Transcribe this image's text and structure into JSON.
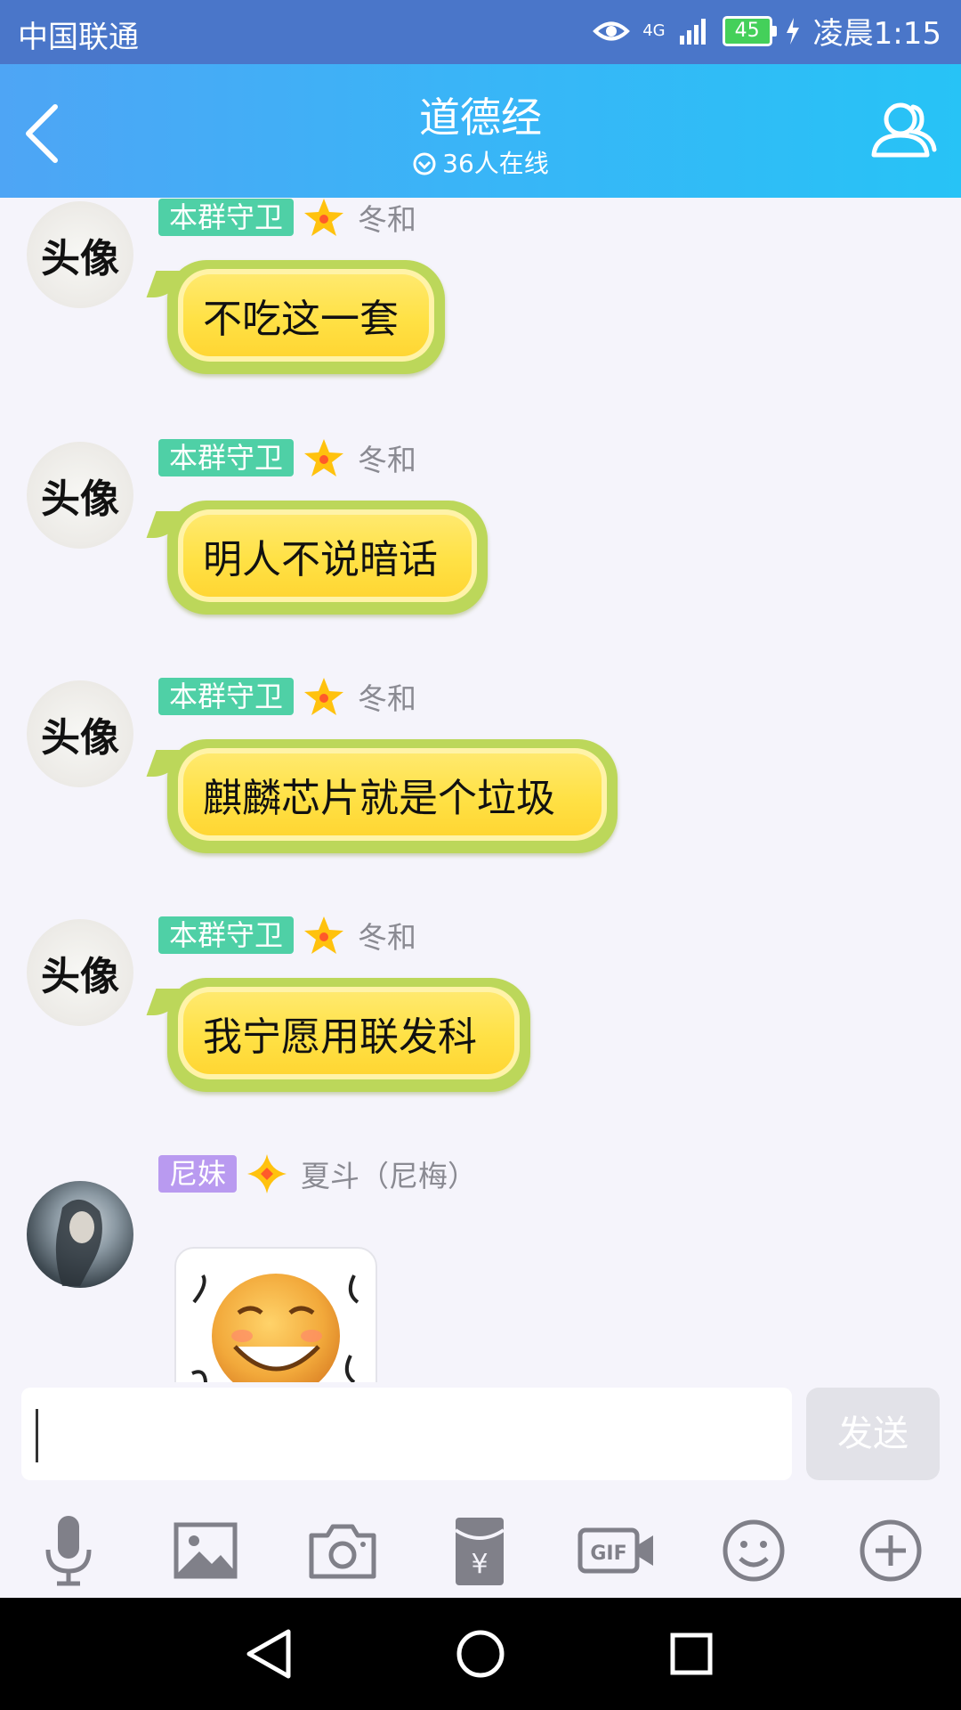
{
  "status_bar": {
    "carrier": "中国联通",
    "network": "4G",
    "battery": "45",
    "time": "凌晨1:15"
  },
  "header": {
    "title": "道德经",
    "online": "36人在线"
  },
  "messages": [
    {
      "avatar_text": "头像",
      "badge": "本群守卫",
      "nickname": "冬和",
      "text": "不吃这一套"
    },
    {
      "avatar_text": "头像",
      "badge": "本群守卫",
      "nickname": "冬和",
      "text": "明人不说暗话"
    },
    {
      "avatar_text": "头像",
      "badge": "本群守卫",
      "nickname": "冬和",
      "text": "麒麟芯片就是个垃圾"
    },
    {
      "avatar_text": "头像",
      "badge": "本群守卫",
      "nickname": "冬和",
      "text": "我宁愿用联发科"
    },
    {
      "badge": "尼妹",
      "nickname": "夏斗（尼梅）",
      "content": "sticker-smiley"
    }
  ],
  "input": {
    "value": "",
    "send_label": "发送"
  },
  "toolbar": [
    "microphone-icon",
    "image-icon",
    "camera-icon",
    "red-packet-icon",
    "gif-icon",
    "emoji-icon",
    "plus-icon"
  ],
  "nav": [
    "back-triangle-icon",
    "home-circle-icon",
    "recents-square-icon"
  ],
  "colors": {
    "header_gradient_start": "#4ea5f5",
    "header_gradient_end": "#27c3f6",
    "badge_green": "#4fd0a6",
    "badge_purple": "#b99af0",
    "bubble_yellow": "#ffe145",
    "bubble_rim": "#bcd75a"
  }
}
